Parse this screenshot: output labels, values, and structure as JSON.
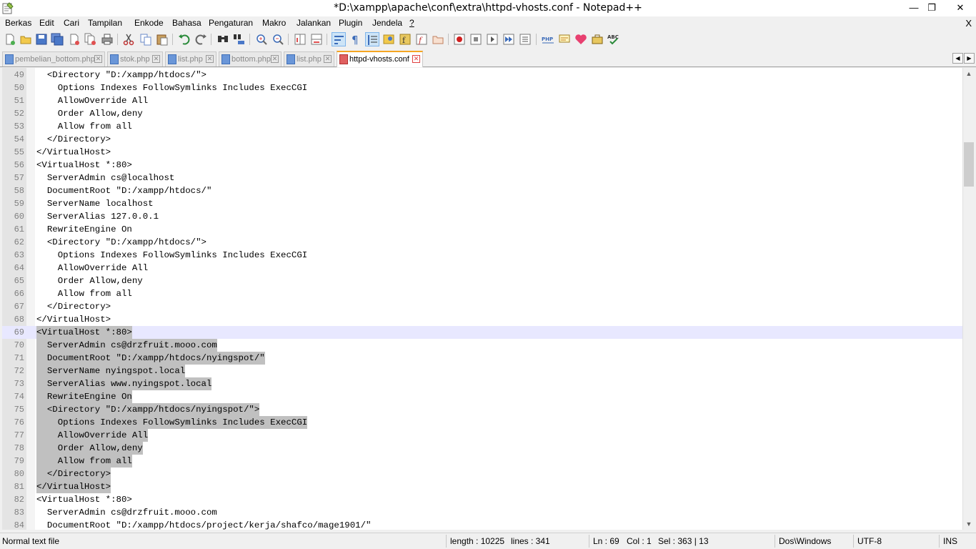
{
  "window": {
    "title": "*D:\\xampp\\apache\\conf\\extra\\httpd-vhosts.conf - Notepad++",
    "minimize": "—",
    "maximize": "❐",
    "close": "✕"
  },
  "menu": {
    "items": [
      "Berkas",
      "Edit",
      "Cari",
      "Tampilan",
      "Enkode",
      "Bahasa",
      "Pengaturan",
      "Makro",
      "Jalankan",
      "Plugin",
      "Jendela",
      "?"
    ],
    "close_label": "X"
  },
  "tabs": [
    {
      "label": "pembelian_bottom.php",
      "active": false
    },
    {
      "label": "stok.php",
      "active": false
    },
    {
      "label": "list.php",
      "active": false
    },
    {
      "label": "bottom.php",
      "active": false
    },
    {
      "label": "list.php",
      "active": false
    },
    {
      "label": "httpd-vhosts.conf",
      "active": true
    }
  ],
  "tab_nav": {
    "left": "◀",
    "right": "▶"
  },
  "editor": {
    "lines": [
      {
        "n": "49",
        "text": "  <Directory \"D:/xampp/htdocs/\">"
      },
      {
        "n": "50",
        "text": "    Options Indexes FollowSymlinks Includes ExecCGI"
      },
      {
        "n": "51",
        "text": "    AllowOverride All"
      },
      {
        "n": "52",
        "text": "    Order Allow,deny"
      },
      {
        "n": "53",
        "text": "    Allow from all"
      },
      {
        "n": "54",
        "text": "  </Directory>"
      },
      {
        "n": "55",
        "text": "</VirtualHost>"
      },
      {
        "n": "56",
        "text": "<VirtualHost *:80>"
      },
      {
        "n": "57",
        "text": "  ServerAdmin cs@localhost"
      },
      {
        "n": "58",
        "text": "  DocumentRoot \"D:/xampp/htdocs/\""
      },
      {
        "n": "59",
        "text": "  ServerName localhost"
      },
      {
        "n": "60",
        "text": "  ServerAlias 127.0.0.1"
      },
      {
        "n": "61",
        "text": "  RewriteEngine On"
      },
      {
        "n": "62",
        "text": "  <Directory \"D:/xampp/htdocs/\">"
      },
      {
        "n": "63",
        "text": "    Options Indexes FollowSymlinks Includes ExecCGI"
      },
      {
        "n": "64",
        "text": "    AllowOverride All"
      },
      {
        "n": "65",
        "text": "    Order Allow,deny"
      },
      {
        "n": "66",
        "text": "    Allow from all"
      },
      {
        "n": "67",
        "text": "  </Directory>"
      },
      {
        "n": "68",
        "text": "</VirtualHost>"
      },
      {
        "n": "69",
        "text": "<VirtualHost *:80>"
      },
      {
        "n": "70",
        "text": "  ServerAdmin cs@drzfruit.mooo.com"
      },
      {
        "n": "71",
        "text": "  DocumentRoot \"D:/xampp/htdocs/nyingspot/\""
      },
      {
        "n": "72",
        "text": "  ServerName nyingspot.local"
      },
      {
        "n": "73",
        "text": "  ServerAlias www.nyingspot.local"
      },
      {
        "n": "74",
        "text": "  RewriteEngine On"
      },
      {
        "n": "75",
        "text": "  <Directory \"D:/xampp/htdocs/nyingspot/\">"
      },
      {
        "n": "76",
        "text": "    Options Indexes FollowSymlinks Includes ExecCGI"
      },
      {
        "n": "77",
        "text": "    AllowOverride All"
      },
      {
        "n": "78",
        "text": "    Order Allow,deny"
      },
      {
        "n": "79",
        "text": "    Allow from all"
      },
      {
        "n": "80",
        "text": "  </Directory>"
      },
      {
        "n": "81",
        "text": "</VirtualHost>"
      },
      {
        "n": "82",
        "text": "<VirtualHost *:80>"
      },
      {
        "n": "83",
        "text": "  ServerAdmin cs@drzfruit.mooo.com"
      },
      {
        "n": "84",
        "text": "  DocumentRoot \"D:/xampp/htdocs/project/kerja/shafco/mage1901/\""
      }
    ],
    "current_line": "69",
    "selected_from": "69",
    "selected_to": "81"
  },
  "scrollbar": {
    "up": "▲",
    "down": "▼"
  },
  "status": {
    "file_type": "Normal text file",
    "length": "length : 10225",
    "lines": "lines : 341",
    "ln": "Ln : 69",
    "col": "Col : 1",
    "sel": "Sel : 363 | 13",
    "eol": "Dos\\Windows",
    "encoding": "UTF-8",
    "mode": "INS"
  },
  "toolbar_icons": [
    "new-file-icon",
    "open-file-icon",
    "save-icon",
    "save-all-icon",
    "close-icon",
    "close-all-icon",
    "print-icon",
    "cut-icon",
    "copy-icon",
    "paste-icon",
    "undo-icon",
    "redo-icon",
    "find-icon",
    "replace-icon",
    "zoom-in-icon",
    "zoom-out-icon",
    "sync-vertical-icon",
    "sync-horizontal-icon",
    "word-wrap-icon",
    "show-all-chars-icon",
    "indent-guide-icon",
    "doc-map-icon",
    "function-list-icon",
    "folder-workspace-icon",
    "monitoring-icon",
    "record-macro-icon",
    "stop-record-icon",
    "play-macro-icon",
    "run-macro-multiple-icon",
    "save-macro-icon",
    "php-icon",
    "tag-icon",
    "heart-icon",
    "toolbox-icon",
    "spell-check-icon"
  ],
  "colors": {
    "selection": "#c0c0c0",
    "current_line": "#e8e8ff",
    "active_tab_accent": "#f5a623",
    "gutter": "#e4e4e4"
  }
}
